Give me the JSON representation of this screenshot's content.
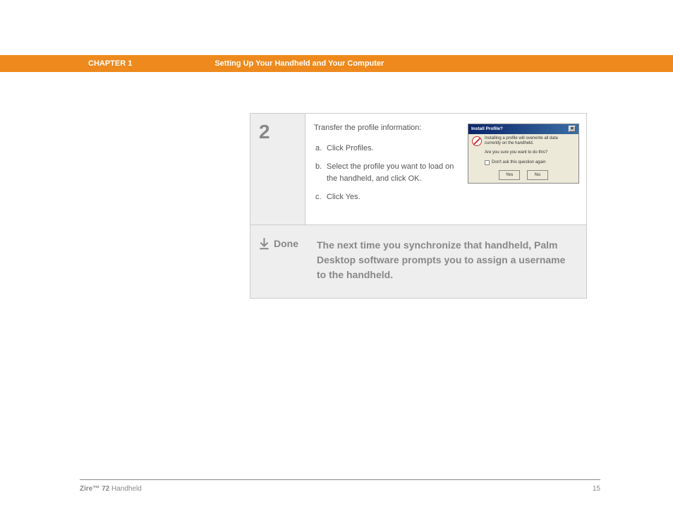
{
  "header": {
    "chapter": "CHAPTER 1",
    "title": "Setting Up Your Handheld and Your Computer"
  },
  "step": {
    "number": "2",
    "intro": "Transfer the profile information:",
    "items": [
      {
        "letter": "a.",
        "text": "Click Profiles."
      },
      {
        "letter": "b.",
        "text": "Select the profile you want to load on the handheld, and click OK."
      },
      {
        "letter": "c.",
        "text": "Click Yes."
      }
    ]
  },
  "dialog": {
    "title": "Install Profile?",
    "message": "Installing a profile will overwrite all data currently on the handheld.",
    "question": "Are you sure you want to do this?",
    "checkbox": "Don't ask this question again",
    "yes": "Yes",
    "no": "No"
  },
  "done": {
    "label": "Done",
    "text": "The next time you synchronize that handheld, Palm Desktop software prompts you to assign a username to the handheld."
  },
  "footer": {
    "product_bold": "Zire™ 72",
    "product_rest": " Handheld",
    "page": "15"
  }
}
